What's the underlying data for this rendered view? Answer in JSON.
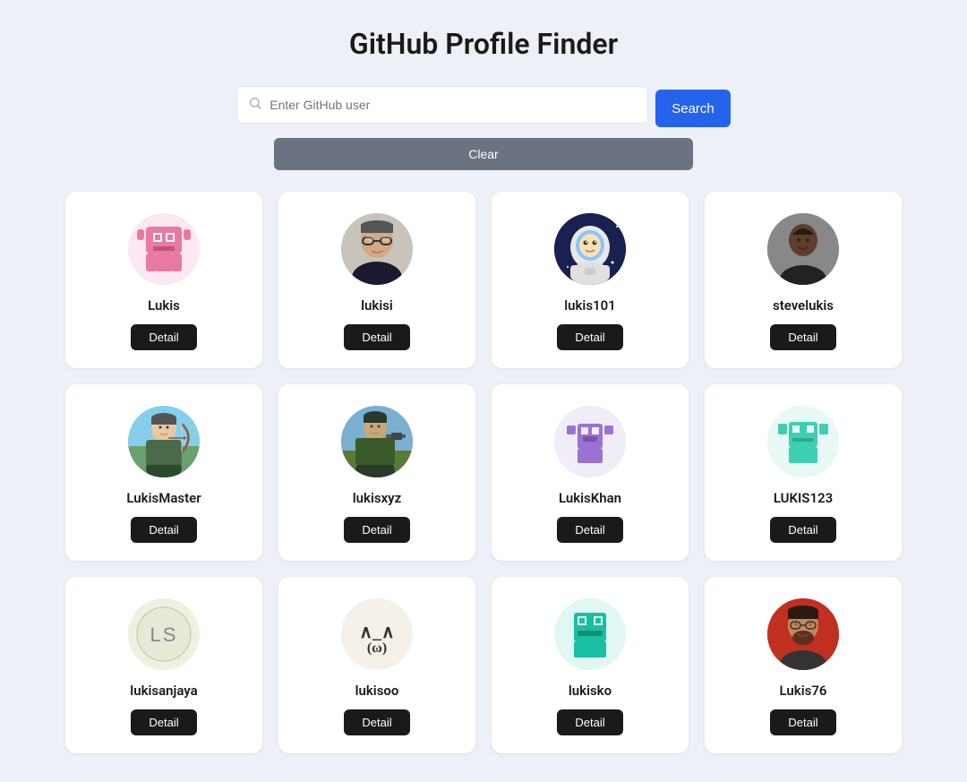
{
  "page": {
    "title": "GitHub Profile Finder"
  },
  "search": {
    "placeholder": "Enter GitHub user",
    "search_label": "Search",
    "clear_label": "Clear"
  },
  "profiles": [
    {
      "username": "Lukis",
      "avatar_type": "pixel_pink",
      "detail_label": "Detail"
    },
    {
      "username": "lukisi",
      "avatar_type": "photo_man_glasses",
      "detail_label": "Detail"
    },
    {
      "username": "lukis101",
      "avatar_type": "photo_astronaut_cartoon",
      "detail_label": "Detail"
    },
    {
      "username": "stevelukis",
      "avatar_type": "photo_man_dark",
      "detail_label": "Detail"
    },
    {
      "username": "LukisMaster",
      "avatar_type": "photo_archer",
      "detail_label": "Detail"
    },
    {
      "username": "lukisxyz",
      "avatar_type": "photo_shooter",
      "detail_label": "Detail"
    },
    {
      "username": "LukisKhan",
      "avatar_type": "pixel_purple",
      "detail_label": "Detail"
    },
    {
      "username": "LUKIS123",
      "avatar_type": "pixel_teal",
      "detail_label": "Detail"
    },
    {
      "username": "lukisanjaya",
      "avatar_type": "initials_ls",
      "detail_label": "Detail"
    },
    {
      "username": "lukisoo",
      "avatar_type": "kaomoji",
      "detail_label": "Detail"
    },
    {
      "username": "lukisko",
      "avatar_type": "pixel_teal2",
      "detail_label": "Detail"
    },
    {
      "username": "Lukis76",
      "avatar_type": "photo_man_beard",
      "detail_label": "Detail"
    }
  ]
}
